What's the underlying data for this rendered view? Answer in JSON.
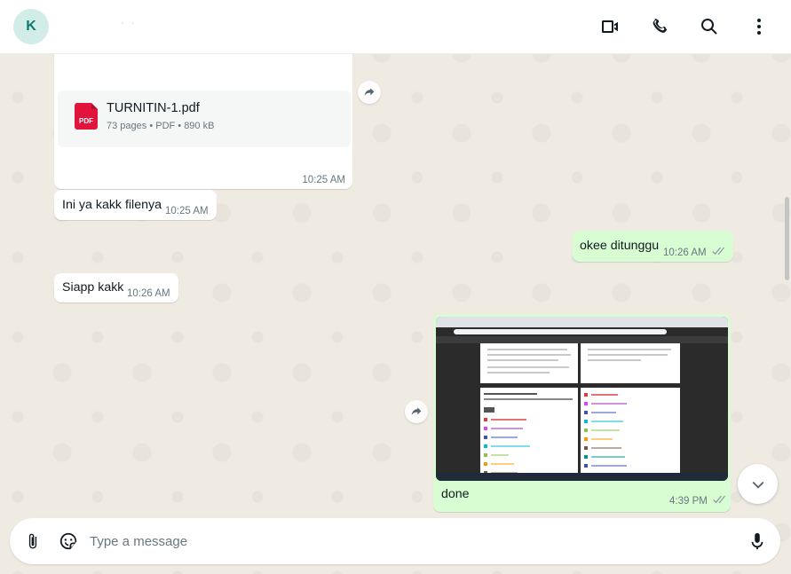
{
  "header": {
    "avatar_initial": "K",
    "contact_name": "· ·",
    "video_icon": "video-call-icon",
    "call_icon": "phone-icon",
    "search_icon": "search-icon",
    "menu_icon": "menu-icon"
  },
  "messages": [
    {
      "direction": "incoming",
      "type": "document",
      "file_name": "TURNITIN-1.pdf",
      "file_meta": "73 pages • PDF • 890 kB",
      "file_badge": "PDF",
      "time": "10:25 AM"
    },
    {
      "direction": "incoming",
      "type": "text",
      "text": "Ini ya kakk filenya",
      "time": "10:25 AM"
    },
    {
      "direction": "outgoing",
      "type": "text",
      "text": "okee ditunggu",
      "time": "10:26 AM"
    },
    {
      "direction": "incoming",
      "type": "text",
      "text": "Siapp kakk",
      "time": "10:26 AM"
    },
    {
      "direction": "outgoing",
      "type": "image",
      "caption": "done",
      "time": "4:39 PM"
    }
  ],
  "composer": {
    "placeholder": "Type a message"
  },
  "colors": {
    "incoming_bubble": "#ffffff",
    "outgoing_bubble": "#d9fdd3",
    "wallpaper": "#efeae2",
    "avatar_bg": "#d2ede8",
    "pdf_red": "#e1153c"
  }
}
